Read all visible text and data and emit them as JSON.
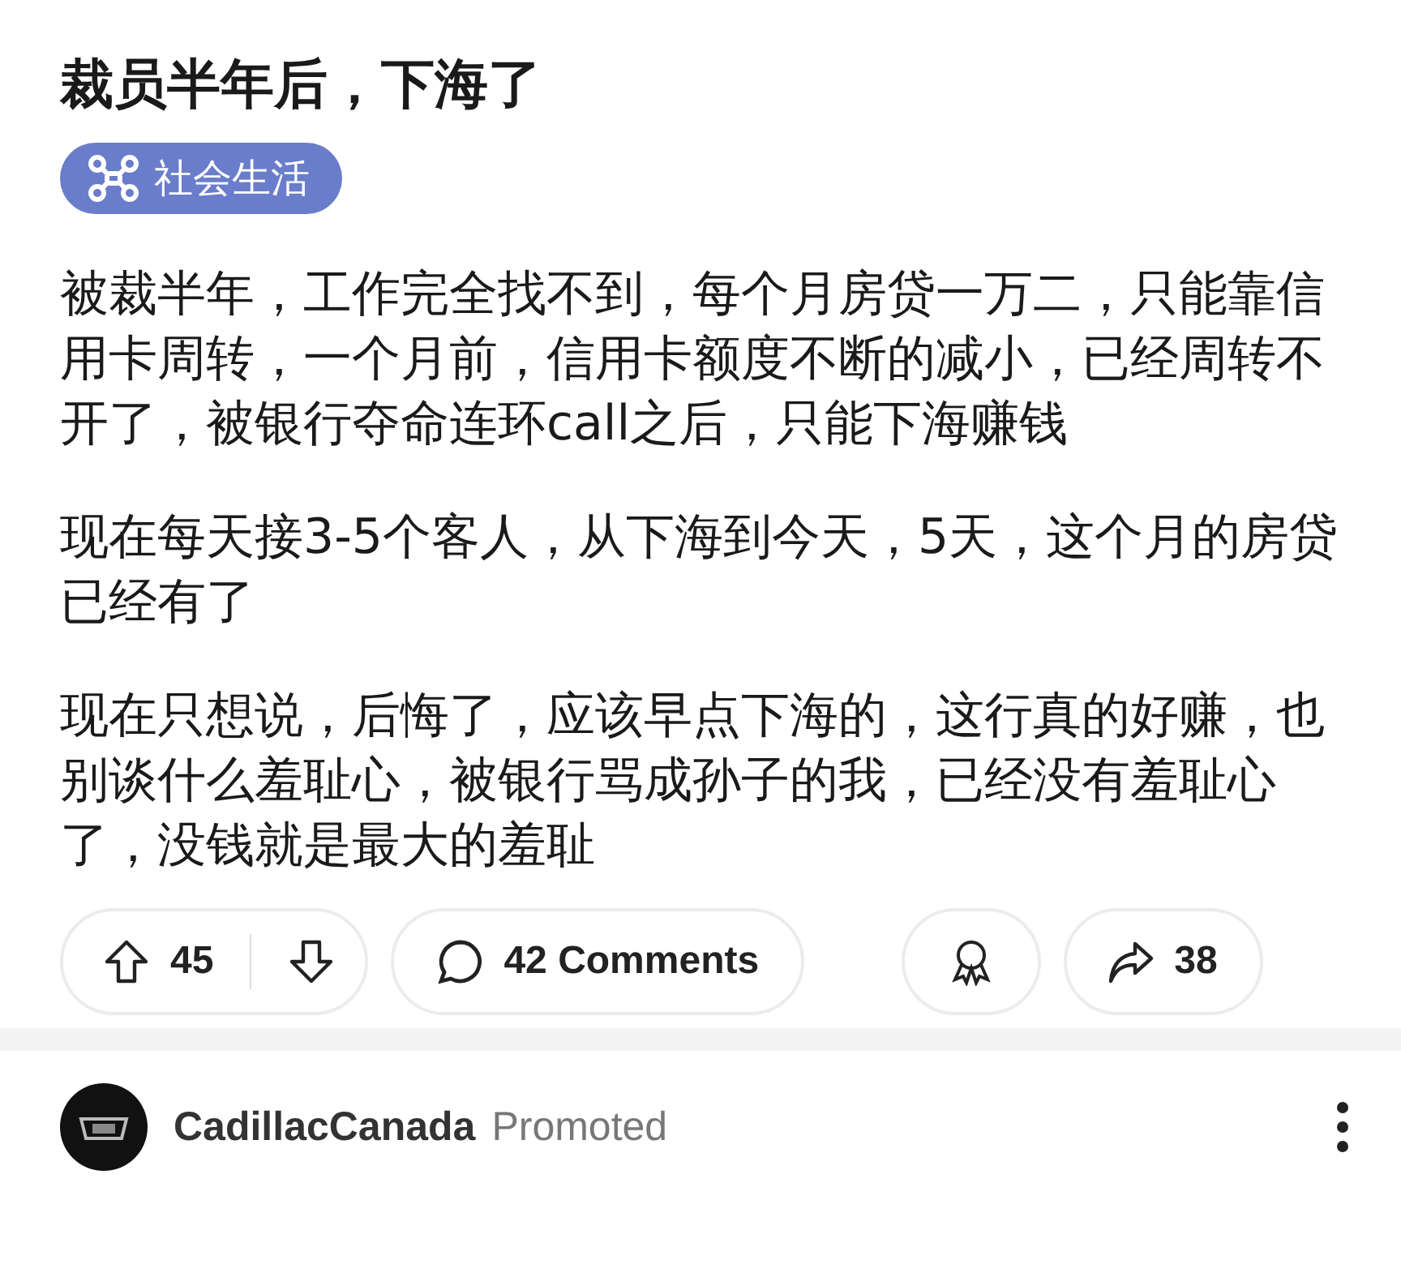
{
  "post": {
    "title": "裁员半年后，下海了",
    "flair": "社会生活",
    "paragraphs": [
      "被裁半年，工作完全找不到，每个月房贷一万二，只能靠信用卡周转，一个月前，信用卡额度不断的减小，已经周转不开了，被银行夺命连环call之后，只能下海赚钱",
      "现在每天接3-5个客人，从下海到今天，5天，这个月的房贷已经有了",
      "现在只想说，后悔了，应该早点下海的，这行真的好赚，也别谈什么羞耻心，被银行骂成孙子的我，已经没有羞耻心了，没钱就是最大的羞耻"
    ]
  },
  "actions": {
    "votes": "45",
    "comments": "42 Comments",
    "shares": "38"
  },
  "promoted": {
    "name": "CadillacCanada",
    "label": "Promoted"
  }
}
